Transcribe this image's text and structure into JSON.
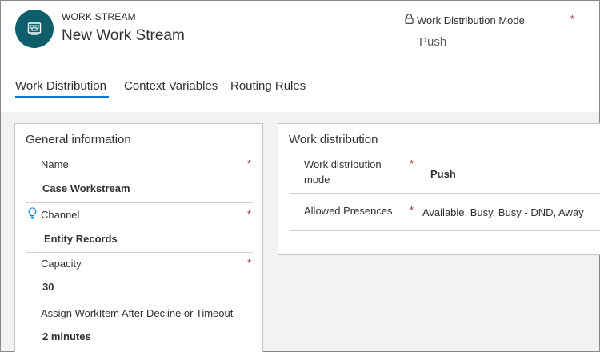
{
  "header": {
    "entity_type": "WORK STREAM",
    "record_title": "New Work Stream",
    "icon": "workstream-icon",
    "header_field": {
      "label": "Work Distribution Mode",
      "required_mark": "*",
      "value": "Push",
      "icon": "lock-icon"
    }
  },
  "tabs": [
    {
      "label": "Work Distribution",
      "active": true
    },
    {
      "label": "Context Variables",
      "active": false
    },
    {
      "label": "Routing Rules",
      "active": false
    }
  ],
  "general_information": {
    "title": "General information",
    "fields": [
      {
        "label": "Name",
        "required_mark": "*",
        "value": "Case Workstream"
      },
      {
        "label": "Channel",
        "required_mark": "*",
        "value": "Entity Records",
        "icon": "lightbulb-icon"
      },
      {
        "label": "Capacity",
        "required_mark": "*",
        "value": "30"
      },
      {
        "label": "Assign WorkItem After Decline or Timeout",
        "required_mark": "",
        "value": "2 minutes"
      }
    ]
  },
  "work_distribution": {
    "title": "Work distribution",
    "fields": [
      {
        "label_line1": "Work distribution",
        "label_line2": "mode",
        "required_mark": "*",
        "value": "Push"
      },
      {
        "label": "Allowed Presences",
        "required_mark": "*",
        "value": "Available, Busy, Busy - DND, Away"
      }
    ]
  },
  "colors": {
    "accent": "#0078d4",
    "entity_icon_bg": "#0e5f6b",
    "required": "#a4262c",
    "background_grey": "#f3f2f1"
  }
}
